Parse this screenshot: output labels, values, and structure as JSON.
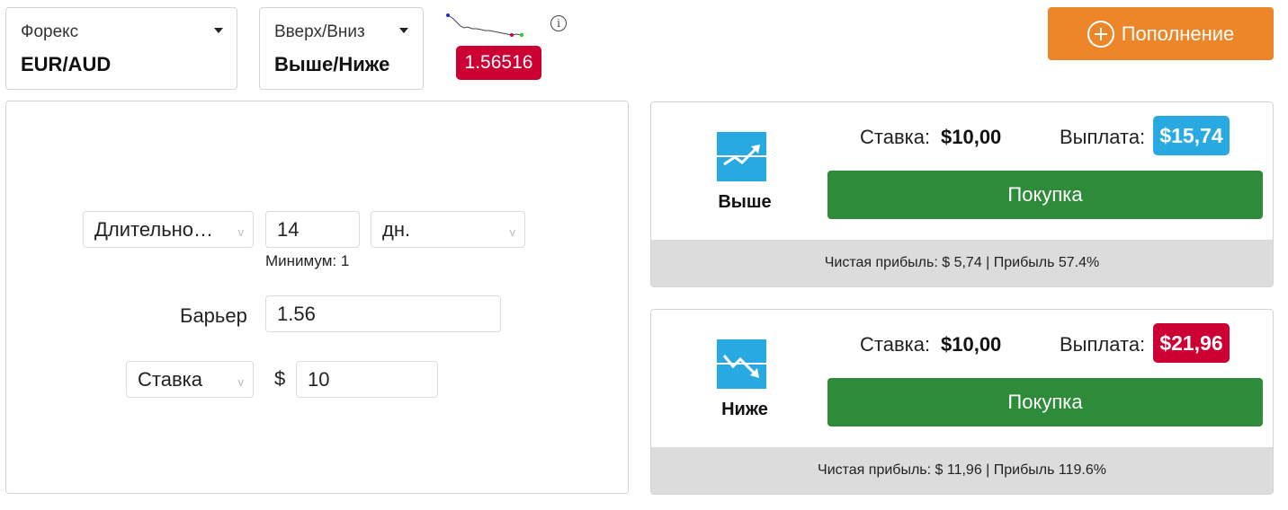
{
  "market_selector": {
    "caption": "Форекс",
    "value": "EUR/AUD"
  },
  "type_selector": {
    "caption": "Вверх/Вниз",
    "value": "Выше/Ниже"
  },
  "price": {
    "value": "1.56516",
    "color": "#cc0033"
  },
  "deposit": {
    "label": "Пополнение",
    "color": "#ec8629"
  },
  "form": {
    "duration_type": "Длительно…",
    "duration_value": "14",
    "duration_unit": "дн.",
    "minimum_note": "Минимум: 1",
    "barrier_label": "Барьер",
    "barrier_value": "1.56",
    "stake_type": "Ставка",
    "currency_symbol": "$",
    "stake_value": "10"
  },
  "contracts": [
    {
      "direction": "Выше",
      "icon": "trend-up-icon",
      "stake_caption": "Ставка:",
      "stake_value": "$10,00",
      "payout_caption": "Выплата:",
      "payout_value": "$15,74",
      "payout_color": "#29a9e1",
      "buy_label": "Покупка",
      "profit_text": "Чистая прибыль: $ 5,74 | Прибыль 57.4%"
    },
    {
      "direction": "Ниже",
      "icon": "trend-down-icon",
      "stake_caption": "Ставка:",
      "stake_value": "$10,00",
      "payout_caption": "Выплата:",
      "payout_value": "$21,96",
      "payout_color": "#cc0033",
      "buy_label": "Покупка",
      "profit_text": "Чистая прибыль: $ 11,96 | Прибыль 119.6%"
    }
  ]
}
